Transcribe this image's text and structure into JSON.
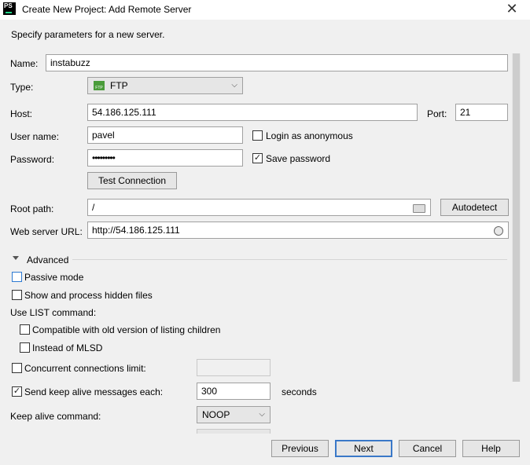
{
  "window": {
    "icon_text": "PS",
    "title": "Create New Project: Add Remote Server",
    "close_glyph": "✕"
  },
  "subtitle": "Specify parameters for a new server.",
  "form": {
    "name_label": "Name:",
    "name_value": "instabuzz",
    "type_label": "Type:",
    "type_value": "FTP",
    "type_icon_text": "FTP",
    "host_label": "Host:",
    "host_value": "54.186.125.111",
    "port_label": "Port:",
    "port_value": "21",
    "username_label": "User name:",
    "username_value": "pavel",
    "login_anonymous_label": "Login as anonymous",
    "login_anonymous_checked": false,
    "password_label": "Password:",
    "password_value": "•••••••••",
    "save_password_label": "Save password",
    "save_password_checked": true,
    "test_connection_label": "Test Connection",
    "root_path_label": "Root path:",
    "root_path_value": "/",
    "autodetect_label": "Autodetect",
    "web_url_label": "Web server URL:",
    "web_url_value": "http://54.186.125.111"
  },
  "advanced": {
    "header": "Advanced",
    "passive_mode_label": "Passive mode",
    "passive_mode_checked": false,
    "hidden_files_label": "Show and process hidden files",
    "hidden_files_checked": false,
    "list_command_label": "Use  LIST command:",
    "compatible_label": "Compatible with old version of listing children",
    "compatible_checked": false,
    "instead_mlsd_label": "Instead of MLSD",
    "instead_mlsd_checked": false,
    "concurrent_label": "Concurrent connections limit:",
    "concurrent_checked": false,
    "keepalive_label": "Send keep alive messages each:",
    "keepalive_checked": true,
    "keepalive_value": "300",
    "keepalive_unit": "seconds",
    "keepalive_cmd_label": "Keep alive command:",
    "keepalive_cmd_value": "NOOP"
  },
  "buttons": {
    "previous": "Previous",
    "next": "Next",
    "cancel": "Cancel",
    "help": "Help"
  },
  "icons": {
    "check": "✓",
    "chevron": "⌵"
  }
}
